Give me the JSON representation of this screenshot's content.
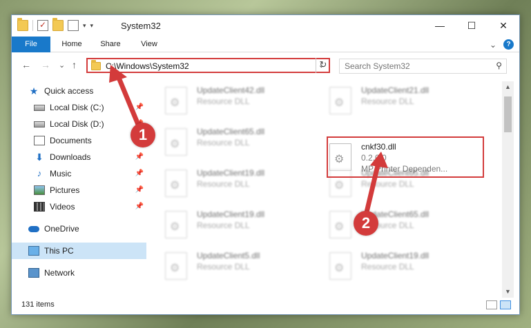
{
  "window": {
    "title": "System32",
    "controls": {
      "minimize": "—",
      "maximize": "☐",
      "close": "✕"
    }
  },
  "ribbon": {
    "tabs": [
      "File",
      "Home",
      "Share",
      "View"
    ],
    "expand": "⌄",
    "help": "?"
  },
  "nav": {
    "back": "←",
    "forward": "→",
    "recent": "⌄",
    "up": "↑",
    "address": "C:\\Windows\\System32",
    "address_dropdown": "⌄",
    "refresh": "↻",
    "search_placeholder": "Search System32",
    "search_icon": "⚲"
  },
  "sidebar": {
    "items": [
      {
        "label": "Quick access",
        "icon": "star-icon",
        "pinned": false
      },
      {
        "label": "Local Disk (C:)",
        "icon": "disk-icon",
        "pinned": true
      },
      {
        "label": "Local Disk (D:)",
        "icon": "disk-icon",
        "pinned": true
      },
      {
        "label": "Documents",
        "icon": "documents-icon",
        "pinned": true
      },
      {
        "label": "Downloads",
        "icon": "downloads-icon",
        "pinned": true
      },
      {
        "label": "Music",
        "icon": "music-icon",
        "pinned": true
      },
      {
        "label": "Pictures",
        "icon": "pictures-icon",
        "pinned": true
      },
      {
        "label": "Videos",
        "icon": "videos-icon",
        "pinned": true
      },
      {
        "label": "OneDrive",
        "icon": "onedrive-icon",
        "pinned": false
      },
      {
        "label": "This PC",
        "icon": "this-pc-icon",
        "pinned": false,
        "selected": true
      },
      {
        "label": "Network",
        "icon": "network-icon",
        "pinned": false
      }
    ],
    "pin_glyph": "📌"
  },
  "files": {
    "left_column": [
      {
        "name": "UpdateClient42.dll",
        "desc": "Resource DLL"
      },
      {
        "name": "UpdateClient65.dll",
        "desc": "Resource DLL"
      },
      {
        "name": "UpdateClient19.dll",
        "desc": "Resource DLL"
      },
      {
        "name": "UpdateClient19.dll",
        "desc": "Resource DLL"
      },
      {
        "name": "UpdateClient5.dll",
        "desc": "Resource DLL"
      }
    ],
    "right_column": [
      {
        "name": "UpdateClient21.dll",
        "desc": "Resource DLL"
      },
      {
        "name": "cnkf30.dll",
        "desc": "0.2.0.0",
        "desc2": "MP Printer Dependen...",
        "highlighted": true
      },
      {
        "name": "UpdateClient65.dll",
        "desc": "Resource DLL"
      },
      {
        "name": "UpdateClient65.dll",
        "desc": "Resource DLL"
      },
      {
        "name": "UpdateClient19.dll",
        "desc": "Resource DLL"
      }
    ]
  },
  "status": {
    "item_count": "131 items"
  },
  "callouts": {
    "one": "1",
    "two": "2"
  },
  "colors": {
    "accent": "#1979ca",
    "callout": "#d33b3b",
    "selected": "#cce4f7"
  }
}
